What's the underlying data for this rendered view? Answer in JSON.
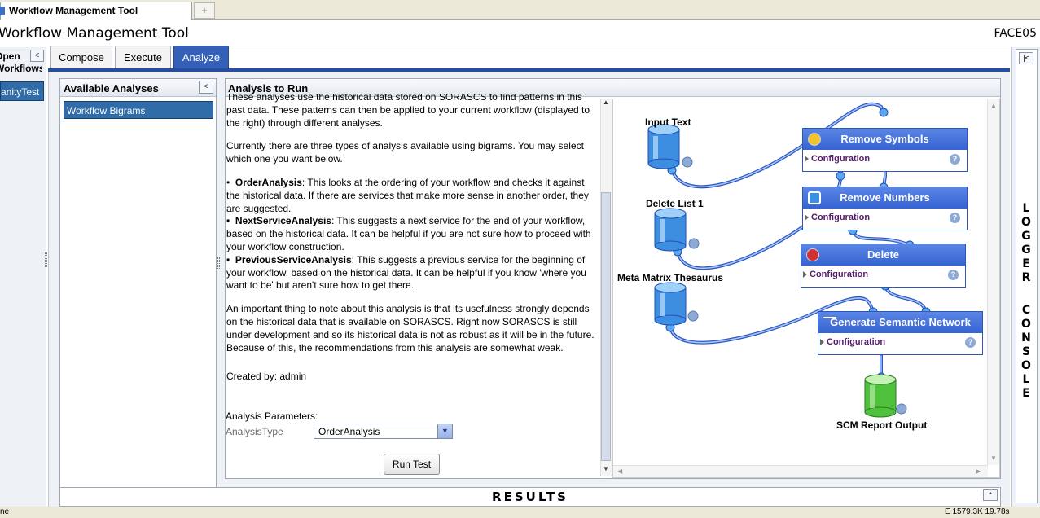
{
  "browser_tab": {
    "title": "Workflow Management Tool",
    "new_tab_symbol": "+"
  },
  "app": {
    "title": "Workflow Management Tool",
    "code": "FACE05"
  },
  "open_workflows": {
    "title_line1": "Open",
    "title_line2": "Workflows",
    "collapse_symbol": "<",
    "items": [
      "SanityTest"
    ]
  },
  "tabs": [
    {
      "label": "Compose",
      "active": false
    },
    {
      "label": "Execute",
      "active": false
    },
    {
      "label": "Analyze",
      "active": true
    }
  ],
  "available_analyses": {
    "title": "Available Analyses",
    "collapse_symbol": "<",
    "items": [
      "Workflow Bigrams"
    ]
  },
  "analysis_to_run": {
    "title": "Analysis to Run",
    "intro": "These analyses use the historical data stored on SORASCS to find patterns in this past data. These patterns can then be applied to your current workflow (displayed to the right) through different analyses.",
    "types_intro": "Currently there are three types of analysis available using bigrams.  You may select which one you want below.",
    "items": [
      {
        "name": "OrderAnalysis",
        "text": ": This looks at the ordering of your workflow and checks it against the historical data. If there are services that make more sense in another order, they are suggested."
      },
      {
        "name": "NextServiceAnalysis",
        "text": ": This suggests a next service for the end of your workflow, based on the historical data. It can be helpful if you are not sure how to proceed with your workflow construction."
      },
      {
        "name": "PreviousServiceAnalysis",
        "text": ": This suggests a previous service for the beginning of your workflow, based on the historical data. It can be helpful if you know 'where you want to be' but aren't sure how to get there."
      }
    ],
    "note": "An important thing to note about this analysis is that its usefulness strongly depends on the historical data that is available on SORASCS. Right now SORASCS is still under development and so its historical data is not as robust as it will be in the future. Because of this, the recommendations from this analysis are somewhat weak.",
    "created_by": "Created by: admin",
    "params_label": "Analysis Parameters:",
    "type_label": "AnalysisType",
    "type_value": "OrderAnalysis",
    "run_button": "Run Test"
  },
  "workflow": {
    "inputs": [
      {
        "label": "Input Text",
        "color": "#2f7fd0"
      },
      {
        "label": "Delete List 1",
        "color": "#2f7fd0"
      },
      {
        "label": "Meta Matrix Thesaurus",
        "color": "#2f7fd0"
      }
    ],
    "services": [
      {
        "name": "Remove Symbols",
        "config": "Configuration",
        "icon": "gear-icon"
      },
      {
        "name": "Remove Numbers",
        "config": "Configuration",
        "icon": "square-icon"
      },
      {
        "name": "Delete",
        "config": "Configuration",
        "icon": "x-icon"
      },
      {
        "name": "Generate Semantic Network",
        "config": "Configuration",
        "icon": "minus-icon"
      }
    ],
    "output": {
      "label": "SCM Report Output",
      "color": "#3cad2c"
    },
    "help_symbol": "?"
  },
  "results": {
    "title": "RESULTS",
    "max_symbol": "⌃"
  },
  "logger": {
    "word1": "LOGGER",
    "word2": "CONSOLE",
    "expand_symbol": "|<"
  },
  "status": {
    "left": "ne",
    "right": "E    1579.3K   19.78s"
  },
  "colors": {
    "accent": "#3560b8",
    "selection": "#2f6ca8",
    "service_bar": "#3563d3"
  }
}
